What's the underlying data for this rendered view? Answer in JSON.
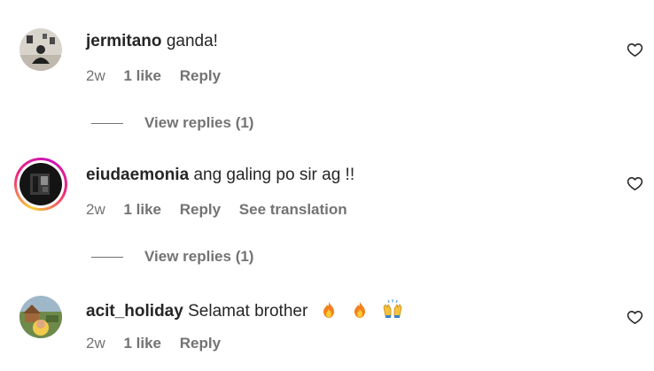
{
  "comments": [
    {
      "username": "jermitano",
      "text": "ganda!",
      "time": "2w",
      "likes": "1 like",
      "reply": "Reply",
      "view_replies": "View replies (1)"
    },
    {
      "username": "eiudaemonia",
      "text": "ang galing po sir ag !!",
      "time": "2w",
      "likes": "1 like",
      "reply": "Reply",
      "translate": "See translation",
      "view_replies": "View replies (1)"
    },
    {
      "username": "acit_holiday",
      "text": "Selamat brother",
      "emojis": [
        "fire-emoji",
        "fire-emoji",
        "raising-hands-emoji"
      ],
      "time": "2w",
      "likes": "1 like",
      "reply": "Reply"
    }
  ],
  "colors": {
    "text": "#262626",
    "secondary": "#737373",
    "story_ring": [
      "#f9ce34",
      "#ee2a7b",
      "#c913b9"
    ]
  },
  "icons": {
    "like": "heart-outline-icon"
  }
}
